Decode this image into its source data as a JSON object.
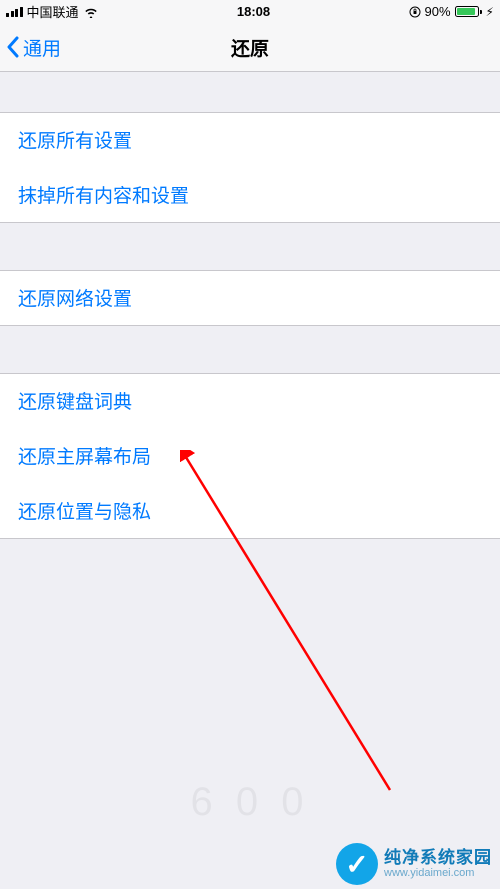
{
  "status_bar": {
    "carrier": "中国联通",
    "time": "18:08",
    "battery_percent": "90%"
  },
  "nav": {
    "back_label": "通用",
    "title": "还原"
  },
  "groups": [
    {
      "items": [
        {
          "label": "还原所有设置"
        },
        {
          "label": "抹掉所有内容和设置"
        }
      ]
    },
    {
      "items": [
        {
          "label": "还原网络设置"
        }
      ]
    },
    {
      "items": [
        {
          "label": "还原键盘词典"
        },
        {
          "label": "还原主屏幕布局"
        },
        {
          "label": "还原位置与隐私"
        }
      ]
    }
  ],
  "watermark": {
    "center": "6 0 0",
    "brand_name": "纯净系统家园",
    "brand_url": "www.yidaimei.com"
  }
}
